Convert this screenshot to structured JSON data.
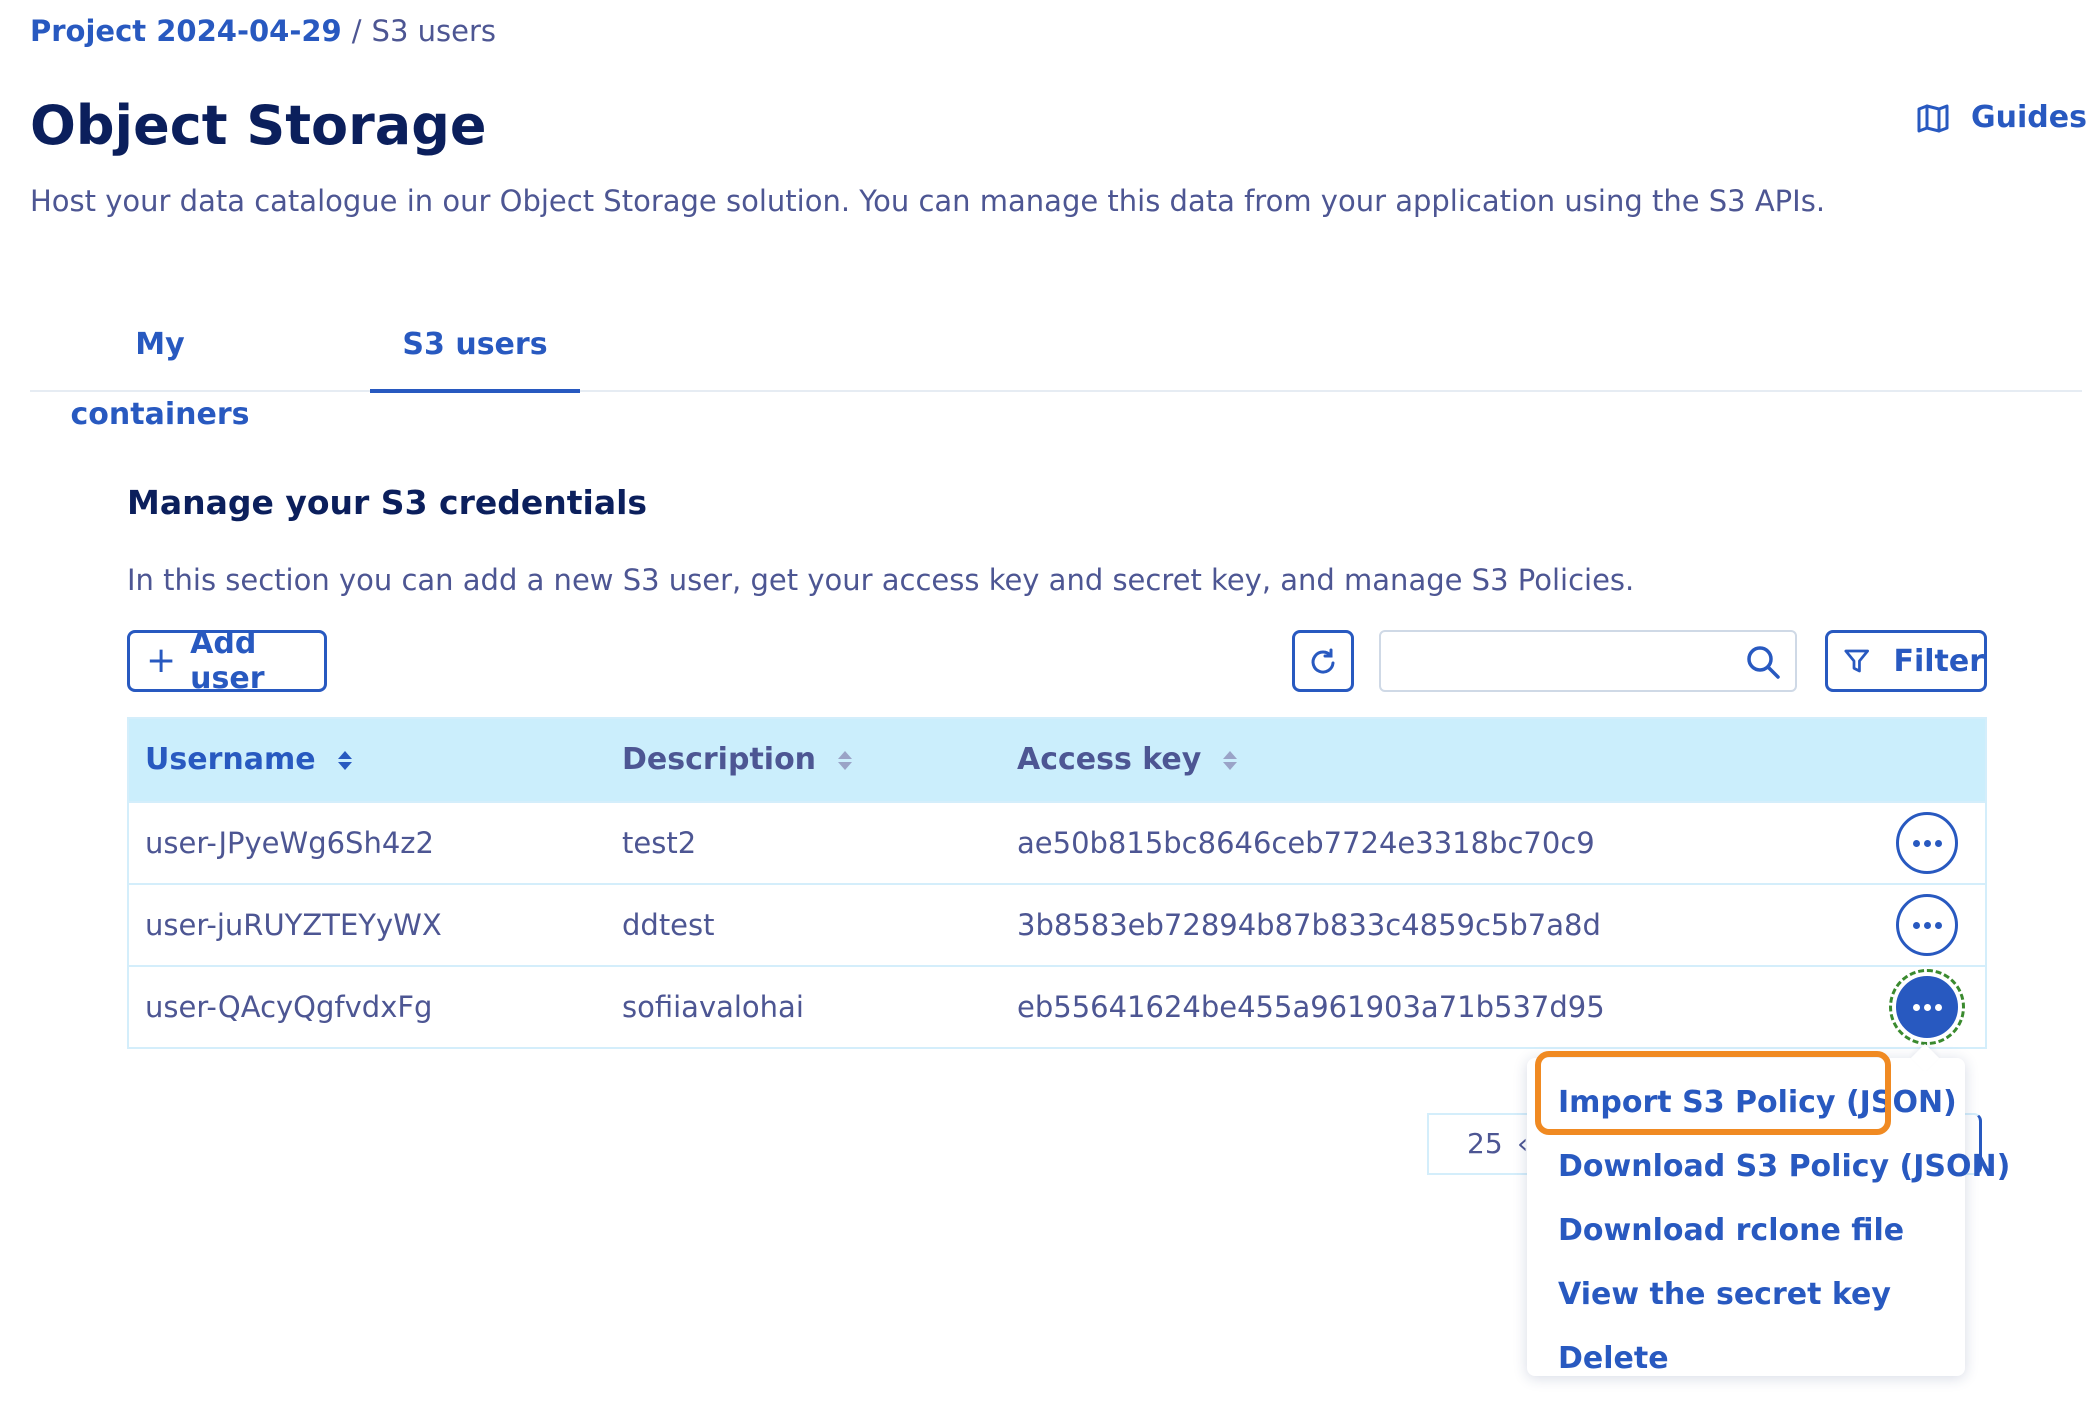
{
  "breadcrumb": {
    "project": "Project 2024-04-29",
    "separator": "/",
    "current": "S3 users"
  },
  "header": {
    "title": "Object Storage",
    "subtitle": "Host your data catalogue in our Object Storage solution. You can manage this data from your application using the S3 APIs.",
    "guides_label": "Guides",
    "guides_icon": "book-map-icon"
  },
  "tabs": [
    {
      "label": "My containers",
      "active": false
    },
    {
      "label": "S3 users",
      "active": true
    }
  ],
  "section": {
    "title": "Manage your S3 credentials",
    "description": "In this section you can add a new S3 user, get your access key and secret key, and manage S3 Policies."
  },
  "toolbar": {
    "add_user_icon": "plus-icon",
    "add_user_label": "Add user",
    "refresh_icon": "refresh-icon",
    "search_value": "",
    "search_placeholder": "",
    "search_icon": "search-icon",
    "filter_icon": "filter-icon",
    "filter_label": "Filter"
  },
  "table": {
    "columns": [
      {
        "label": "Username",
        "sortable": true,
        "active_sort": true
      },
      {
        "label": "Description",
        "sortable": true,
        "active_sort": false
      },
      {
        "label": "Access key",
        "sortable": true,
        "active_sort": false
      }
    ],
    "rows": [
      {
        "username": "user-JPyeWg6Sh4z2",
        "description": "test2",
        "access_key": "ae50b815bc8646ceb7724e3318bc70c9"
      },
      {
        "username": "user-juRUYZTEYyWX",
        "description": "ddtest",
        "access_key": "3b8583eb72894b87b833c4859c5b7a8d"
      },
      {
        "username": "user-QAcyQgfvdxFg",
        "description": "sofiiavalohai",
        "access_key": "eb55641624be455a961903a71b537d95"
      }
    ],
    "row_action_icon": "more-dots-icon",
    "active_row_index": 2
  },
  "pagination": {
    "per_page": "25",
    "chevron": "‹"
  },
  "menu": {
    "items": [
      {
        "label": "Import S3 Policy (JSON)",
        "highlighted": true
      },
      {
        "label": "Download S3 Policy (JSON)",
        "highlighted": false
      },
      {
        "label": "Download rclone file",
        "highlighted": false
      },
      {
        "label": "View the secret key",
        "highlighted": false
      },
      {
        "label": "Delete",
        "highlighted": false
      }
    ]
  },
  "colors": {
    "primary": "#2859c0",
    "title": "#0b1f5c",
    "text": "#4d5693",
    "table_header_bg": "#cbeefc",
    "highlight": "#f08a22",
    "focus_ring": "#3a8a2e"
  }
}
